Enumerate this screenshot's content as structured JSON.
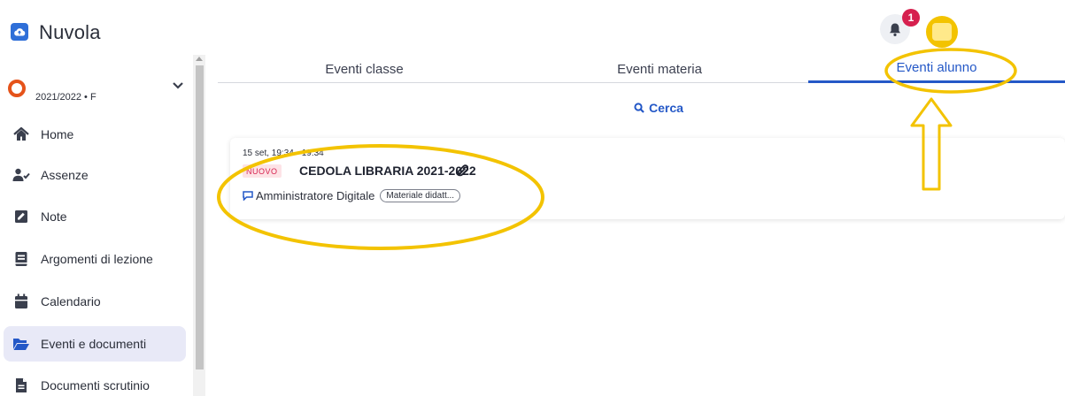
{
  "header": {
    "app_name": "Nuvola",
    "notification_count": "1",
    "icons": {
      "logo": "cloud-logo-icon",
      "bell": "bell-icon",
      "avatar": "user-avatar"
    },
    "colors": {
      "brand": "#2f6fd8",
      "badge": "#d6204e",
      "avatar": "#f3c300"
    }
  },
  "sidebar": {
    "year_selector": {
      "label": "2021/2022 • F",
      "icon": "ring-icon",
      "chevron": "chevron-down-icon"
    },
    "items": [
      {
        "label": "Home",
        "icon": "home-icon",
        "active": false
      },
      {
        "label": "Assenze",
        "icon": "user-check-icon",
        "active": false
      },
      {
        "label": "Note",
        "icon": "note-icon",
        "active": false
      },
      {
        "label": "Argomenti di lezione",
        "icon": "book-icon",
        "active": false
      },
      {
        "label": "Calendario",
        "icon": "calendar-icon",
        "active": false
      },
      {
        "label": "Eventi e documenti",
        "icon": "folder-open-icon",
        "active": true
      },
      {
        "label": "Documenti scrutinio",
        "icon": "document-icon",
        "active": false
      }
    ]
  },
  "main": {
    "tabs": [
      {
        "label": "Eventi classe",
        "active": false
      },
      {
        "label": "Eventi materia",
        "active": false
      },
      {
        "label": "Eventi alunno",
        "active": true
      }
    ],
    "search_label": "Cerca",
    "event": {
      "date": "15 set, 19:34 - 19:34",
      "badge": "NUOVO",
      "title": "CEDOLA LIBRARIA 2021-2022",
      "author": "Amministratore Digitale",
      "tag": "Materiale didatt..."
    },
    "colors": {
      "accent": "#2458c7",
      "new_badge": "#d6204e",
      "annotation": "#f3c300"
    }
  }
}
